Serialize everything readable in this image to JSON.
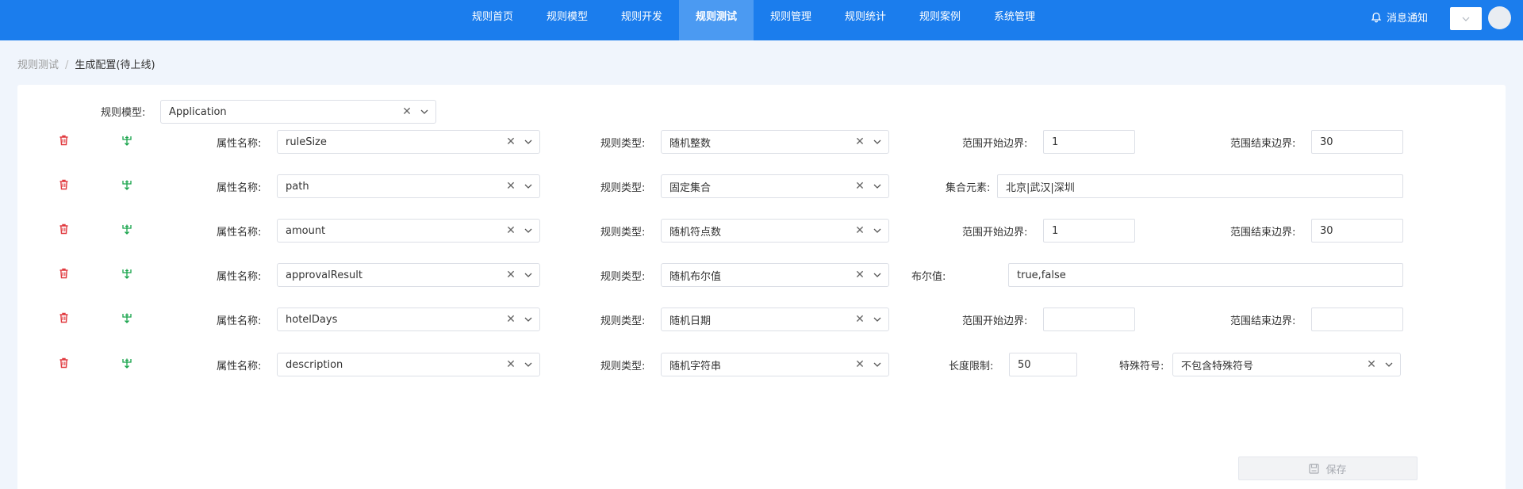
{
  "nav": {
    "items": [
      {
        "label": "规则首页",
        "active": false
      },
      {
        "label": "规则模型",
        "active": false
      },
      {
        "label": "规则开发",
        "active": false
      },
      {
        "label": "规则测试",
        "active": true
      },
      {
        "label": "规则管理",
        "active": false
      },
      {
        "label": "规则统计",
        "active": false
      },
      {
        "label": "规则案例",
        "active": false
      },
      {
        "label": "系统管理",
        "active": false
      }
    ],
    "notify_label": "消息通知",
    "user_select_icon": "chevron-down-icon"
  },
  "breadcrumb": {
    "parent": "规则测试",
    "separator": "/",
    "current": "生成配置(待上线)"
  },
  "model": {
    "label": "规则模型:",
    "value": "Application"
  },
  "row_labels": {
    "attr_name": "属性名称:",
    "rule_type": "规则类型:",
    "range_start": "范围开始边界:",
    "range_end": "范围结束边界:",
    "set_elements": "集合元素:",
    "bool_value": "布尔值:",
    "length_limit": "长度限制:",
    "special_chars": "特殊符号:"
  },
  "rows": [
    {
      "attr": "ruleSize",
      "type": "随机整数",
      "range_start": "1",
      "range_end": "30"
    },
    {
      "attr": "path",
      "type": "固定集合",
      "set_elements": "北京|武汉|深圳"
    },
    {
      "attr": "amount",
      "type": "随机符点数",
      "range_start": "1",
      "range_end": "30"
    },
    {
      "attr": "approvalResult",
      "type": "随机布尔值",
      "bool_value": "true,false"
    },
    {
      "attr": "hotelDays",
      "type": "随机日期",
      "range_start": "",
      "range_end": ""
    },
    {
      "attr": "description",
      "type": "随机字符串",
      "length_limit": "50",
      "special_chars": "不包含特殊符号"
    }
  ],
  "save_label": "保存",
  "colors": {
    "primary": "#1b7ded",
    "delete": "#e0393e",
    "add": "#17a34a"
  },
  "icons": {
    "row_delete": "trash-icon",
    "row_add": "add-branch-icon",
    "clear": "clear-icon",
    "dropdown": "chevron-down-icon",
    "save": "save-icon",
    "notify": "bell-icon"
  }
}
